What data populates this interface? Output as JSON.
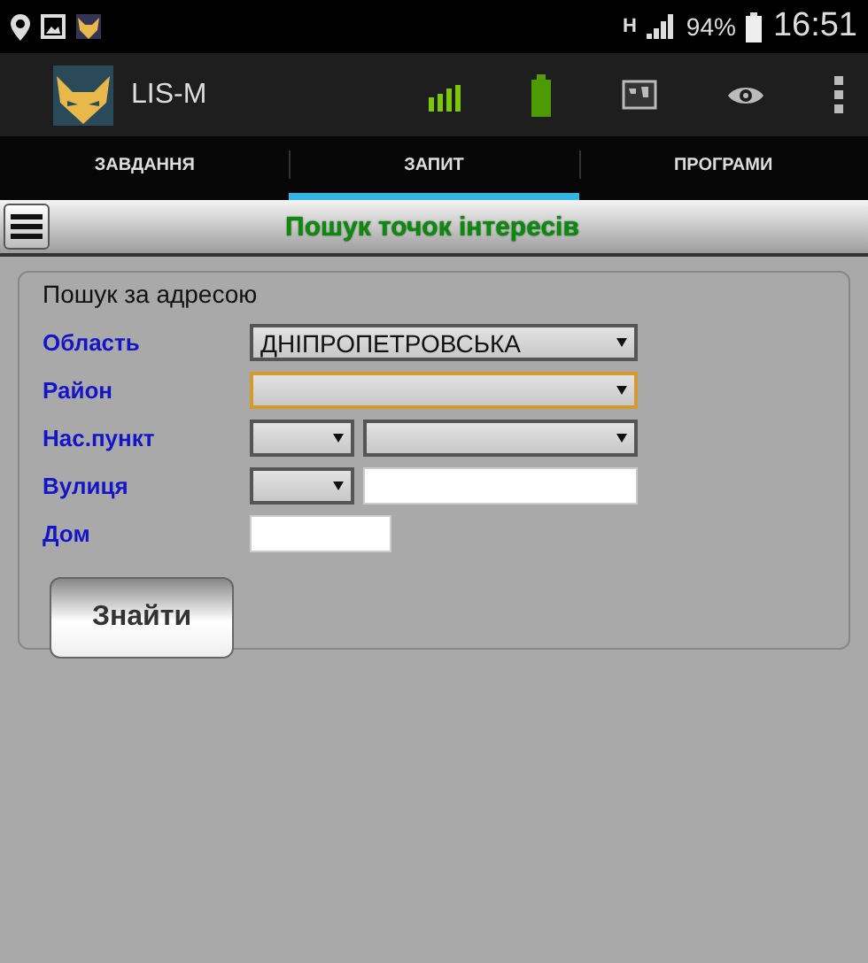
{
  "status_bar": {
    "network": "H",
    "battery": "94%",
    "time": "16:51"
  },
  "action_bar": {
    "title": "LIS-M"
  },
  "tabs": [
    {
      "label": "ЗАВДАННЯ",
      "selected": false
    },
    {
      "label": "ЗАПИТ",
      "selected": true
    },
    {
      "label": "ПРОГРАМИ",
      "selected": false
    }
  ],
  "header": {
    "title": "Пошук точок інтересів"
  },
  "form": {
    "legend": "Пошук за адресою",
    "rows": [
      {
        "label": "Область",
        "controls": [
          {
            "kind": "select",
            "value": "ДНІПРОПЕТРОВСЬКА",
            "focused": false
          }
        ]
      },
      {
        "label": "Район",
        "controls": [
          {
            "kind": "select",
            "focused": true
          }
        ]
      },
      {
        "label": "Нас.пункт",
        "controls": [
          {
            "kind": "select",
            "focused": false
          },
          {
            "kind": "select",
            "focused": false
          }
        ]
      },
      {
        "label": "Вулиця",
        "controls": [
          {
            "kind": "select",
            "focused": false
          },
          {
            "kind": "input"
          }
        ]
      },
      {
        "label": "Дом",
        "controls": [
          {
            "kind": "input"
          }
        ]
      }
    ],
    "button": "Знайти"
  }
}
